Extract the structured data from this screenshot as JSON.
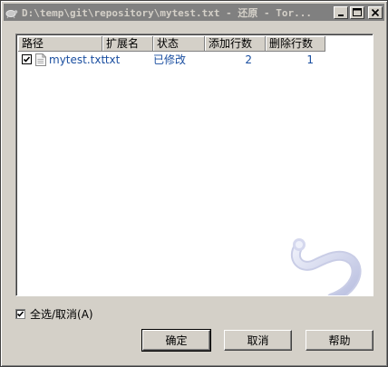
{
  "title": "D:\\temp\\git\\repository\\mytest.txt - 还原 - Tor...",
  "list": {
    "columns": [
      "路径",
      "扩展名",
      "状态",
      "添加行数",
      "删除行数"
    ],
    "rows": [
      {
        "checked": true,
        "path": "mytest.txt",
        "ext": ".txt",
        "status": "已修改",
        "added": "2",
        "deleted": "1"
      }
    ]
  },
  "select_all": {
    "label": "全选/取消(A)",
    "checked": true
  },
  "buttons": {
    "ok": "确定",
    "cancel": "取消",
    "help": "帮助"
  },
  "colors": {
    "titlebar_inactive": "#808080",
    "face": "#d4d0c8",
    "item_text": "#1a4ea0"
  }
}
